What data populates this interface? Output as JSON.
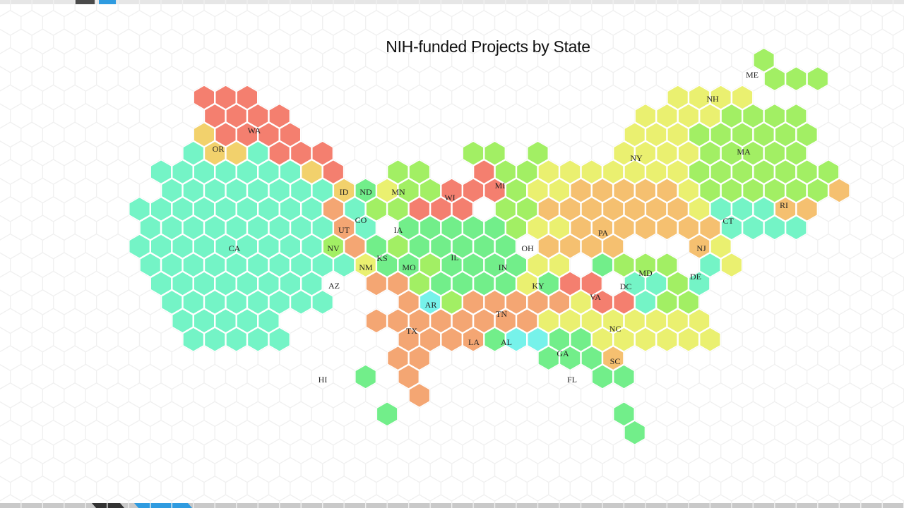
{
  "title": "NIH-funded Projects by State",
  "colors": {
    "teal": "#74f4c6",
    "cyan": "#76f2ea",
    "green": "#72ee8a",
    "lightgreen": "#a2ef64",
    "yellow": "#eaf070",
    "gold": "#f2d16c",
    "lightorange": "#f5c070",
    "orange": "#f4a673",
    "red": "#f47f6f",
    "background_hex": "#f0f0f0"
  },
  "states": [
    {
      "code": "WA",
      "color": "red",
      "cells": [
        [
          -1,
          -1
        ],
        [
          0,
          -1
        ],
        [
          1,
          -1
        ],
        [
          1,
          0
        ],
        [
          2,
          0
        ],
        [
          -1,
          1
        ],
        [
          0,
          1
        ],
        [
          1,
          1
        ],
        [
          2,
          1
        ],
        [
          3,
          1
        ],
        [
          1,
          2
        ],
        [
          2,
          2
        ],
        [
          3,
          2
        ],
        [
          4,
          2
        ],
        [
          4,
          3
        ],
        [
          5,
          3
        ]
      ]
    },
    {
      "code": "OR",
      "color": "gold",
      "cells": [
        [
          -1,
          0
        ],
        [
          0,
          0
        ],
        [
          0,
          1
        ],
        [
          1,
          1
        ]
      ]
    },
    {
      "code": "CA",
      "color": "teal",
      "cells": []
    },
    {
      "code": "ID",
      "color": "green",
      "cells": [
        [
          0,
          0
        ]
      ]
    },
    {
      "code": "ND",
      "color": "yellow",
      "cells": [
        [
          0,
          0
        ]
      ]
    },
    {
      "code": "MN",
      "color": "lightgreen",
      "cells": [
        [
          -1,
          -1
        ],
        [
          0,
          -1
        ],
        [
          1,
          -1
        ],
        [
          -2,
          0
        ],
        [
          -1,
          0
        ],
        [
          0,
          0
        ],
        [
          1,
          0
        ],
        [
          -2,
          1
        ],
        [
          -1,
          1
        ],
        [
          0,
          1
        ],
        [
          1,
          1
        ]
      ]
    },
    {
      "code": "WI",
      "color": "red",
      "cells": [
        [
          0,
          -2
        ],
        [
          -1,
          -1
        ],
        [
          0,
          -1
        ],
        [
          1,
          -1
        ],
        [
          -2,
          0
        ],
        [
          -1,
          0
        ],
        [
          0,
          0
        ],
        [
          1,
          0
        ],
        [
          -1,
          1
        ],
        [
          0,
          1
        ],
        [
          1,
          1
        ]
      ]
    },
    {
      "code": "MI",
      "color": "lightgreen",
      "cells": [
        [
          -4,
          -2
        ],
        [
          -3,
          -2
        ],
        [
          0,
          -2
        ],
        [
          -1,
          -1
        ],
        [
          0,
          -1
        ],
        [
          1,
          -1
        ],
        [
          0,
          0
        ],
        [
          1,
          0
        ],
        [
          0,
          1
        ],
        [
          1,
          1
        ],
        [
          0,
          2
        ],
        [
          -2,
          1
        ]
      ]
    },
    {
      "code": "UT",
      "color": "orange",
      "cells": [
        [
          0,
          -1
        ],
        [
          0,
          0
        ],
        [
          1,
          1
        ]
      ]
    },
    {
      "code": "CO",
      "color": "teal",
      "cells": [
        [
          0,
          0
        ],
        [
          -1,
          0
        ],
        [
          0,
          1
        ]
      ]
    },
    {
      "code": "NV",
      "color": "lightgreen",
      "cells": [
        [
          0,
          0
        ]
      ]
    },
    {
      "code": "AZ",
      "color": "teal",
      "cells": [
        [
          0,
          -1
        ],
        [
          0,
          0
        ],
        [
          -1,
          1
        ]
      ]
    },
    {
      "code": "NM",
      "color": "yellow",
      "cells": [
        [
          0,
          0
        ]
      ]
    },
    {
      "code": "KS",
      "color": "green",
      "cells": [
        [
          0,
          0
        ],
        [
          0,
          -1
        ],
        [
          1,
          -1
        ]
      ]
    },
    {
      "code": "MO",
      "color": "lightgreen",
      "cells": [
        [
          0,
          0
        ],
        [
          0,
          -1
        ],
        [
          0,
          1
        ]
      ]
    },
    {
      "code": "IA",
      "color": "green",
      "cells": [
        [
          0,
          0
        ],
        [
          1,
          0
        ],
        [
          -1,
          0
        ]
      ]
    },
    {
      "code": "IL",
      "color": "green",
      "cells": []
    },
    {
      "code": "IN",
      "color": "green",
      "cells": [
        [
          0,
          0
        ],
        [
          0,
          -1
        ],
        [
          0,
          1
        ],
        [
          -1,
          1
        ]
      ]
    },
    {
      "code": "OH",
      "color": "yellow",
      "cells": [
        [
          0,
          0
        ],
        [
          -1,
          0
        ],
        [
          0,
          -1
        ],
        [
          -1,
          -1
        ],
        [
          -1,
          1
        ],
        [
          0,
          1
        ],
        [
          1,
          -1
        ]
      ]
    },
    {
      "code": "KY",
      "color": "green",
      "cells": [
        [
          0,
          0
        ],
        [
          -1,
          0
        ],
        [
          1,
          0
        ]
      ]
    },
    {
      "code": "AR",
      "color": "cyan",
      "cells": [
        [
          0,
          0
        ]
      ]
    },
    {
      "code": "TX",
      "color": "orange",
      "cells": []
    },
    {
      "code": "LA",
      "color": "green",
      "cells": [
        [
          0,
          0
        ]
      ]
    },
    {
      "code": "AL",
      "color": "cyan",
      "cells": [
        [
          0,
          0
        ],
        [
          -1,
          0
        ]
      ]
    },
    {
      "code": "TN",
      "color": "orange",
      "cells": []
    },
    {
      "code": "GA",
      "color": "green",
      "cells": []
    },
    {
      "code": "FL",
      "color": "green",
      "cells": [
        [
          0,
          0
        ],
        [
          -1,
          0
        ]
      ]
    },
    {
      "code": "SC",
      "color": "lightorange",
      "cells": [
        [
          0,
          0
        ]
      ]
    },
    {
      "code": "NC",
      "color": "yellow",
      "cells": []
    },
    {
      "code": "VA",
      "color": "red",
      "cells": []
    },
    {
      "code": "DC",
      "color": "teal",
      "cells": [
        [
          0,
          0
        ],
        [
          0,
          -1
        ]
      ]
    },
    {
      "code": "MD",
      "color": "lightgreen",
      "cells": []
    },
    {
      "code": "DE",
      "color": "teal",
      "cells": [
        [
          0,
          0
        ],
        [
          0,
          -1
        ]
      ]
    },
    {
      "code": "NJ",
      "color": "yellow",
      "cells": [
        [
          0,
          0
        ],
        [
          0,
          1
        ],
        [
          1,
          1
        ],
        [
          0,
          -1
        ]
      ]
    },
    {
      "code": "PA",
      "color": "lightorange",
      "cells": []
    },
    {
      "code": "NY",
      "color": "yellow",
      "cells": []
    },
    {
      "code": "CT",
      "color": "teal",
      "cells": []
    },
    {
      "code": "RI",
      "color": "lightorange",
      "cells": []
    },
    {
      "code": "MA",
      "color": "lightgreen",
      "cells": []
    },
    {
      "code": "NH",
      "color": "yellow",
      "cells": []
    },
    {
      "code": "ME",
      "color": "lightgreen",
      "cells": []
    },
    {
      "code": "HI",
      "color": "green",
      "cells": [
        [
          0,
          0
        ]
      ]
    }
  ]
}
